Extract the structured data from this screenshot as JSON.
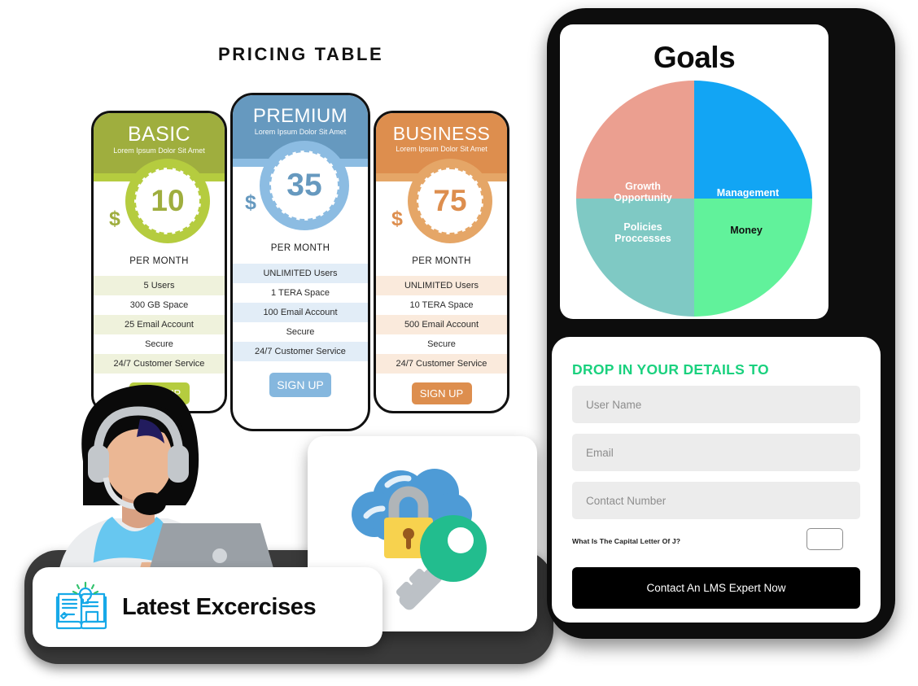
{
  "pricing": {
    "title": "PRICING TABLE",
    "plans": [
      {
        "name": "BASIC",
        "subtitle": "Lorem Ipsum Dolor Sit Amet",
        "currency": "$",
        "price": "10",
        "period": "PER MONTH",
        "features": [
          "5 Users",
          "300 GB Space",
          "25 Email Account",
          "Secure",
          "24/7 Customer Service"
        ],
        "cta": "SIGN UP",
        "colors": {
          "header": "#9FAE3E",
          "ring": "#B5CC3F",
          "stripe": "#B5CC3F",
          "band": "#EFF2DC",
          "text": "#9FAE3E",
          "button": "#B5CC3F"
        }
      },
      {
        "name": "PREMIUM",
        "subtitle": "Lorem Ipsum Dolor Sit Amet",
        "currency": "$",
        "price": "35",
        "period": "PER MONTH",
        "features": [
          "UNLIMITED Users",
          "1 TERA Space",
          "100 Email Account",
          "Secure",
          "24/7 Customer Service"
        ],
        "cta": "SIGN UP",
        "colors": {
          "header": "#6699BF",
          "ring": "#8CBCE2",
          "stripe": "#8CBCE2",
          "band": "#E2EDF7",
          "text": "#6699BF",
          "button": "#85B7DE"
        }
      },
      {
        "name": "BUSINESS",
        "subtitle": "Lorem Ipsum Dolor Sit Amet",
        "currency": "$",
        "price": "75",
        "period": "PER MONTH",
        "features": [
          "UNLIMITED Users",
          "10 TERA Space",
          "500 Email Account",
          "Secure",
          "24/7 Customer Service"
        ],
        "cta": "SIGN UP",
        "colors": {
          "header": "#DD8E4E",
          "ring": "#E5A667",
          "stripe": "#E5A667",
          "band": "#FAEADC",
          "text": "#DD8E4E",
          "button": "#DD8E4E"
        }
      }
    ]
  },
  "goals": {
    "title": "Goals"
  },
  "chart_data": {
    "type": "pie",
    "title": "Goals",
    "labels": [
      "Management",
      "Money",
      "Policies Proccesses",
      "Growth Opportunity"
    ],
    "values": [
      25,
      25,
      25,
      25
    ],
    "colors": [
      "#12A5F4",
      "#61F29B",
      "#7FC9C4",
      "#EB9F90"
    ],
    "label_colors": [
      "#ffffff",
      "#111111",
      "#ffffff",
      "#ffffff"
    ],
    "legend": "none",
    "grid": false
  },
  "form": {
    "title": "DROP IN YOUR DETAILS TO",
    "fields": [
      {
        "name": "username",
        "placeholder": "User Name",
        "value": ""
      },
      {
        "name": "email",
        "placeholder": "Email",
        "value": ""
      },
      {
        "name": "contact",
        "placeholder": "Contact Number",
        "value": ""
      }
    ],
    "captcha_question": "What Is The Capital Letter Of J?",
    "captcha_value": "",
    "submit_label": "Contact An LMS Expert Now",
    "accent": "#1ad17e"
  },
  "latest": {
    "label": "Latest Excercises",
    "icon": "book-lightbulb-icon"
  },
  "security": {
    "icon": "cloud-lock-key-icon"
  },
  "support": {
    "icon": "customer-service-agent-illustration"
  }
}
